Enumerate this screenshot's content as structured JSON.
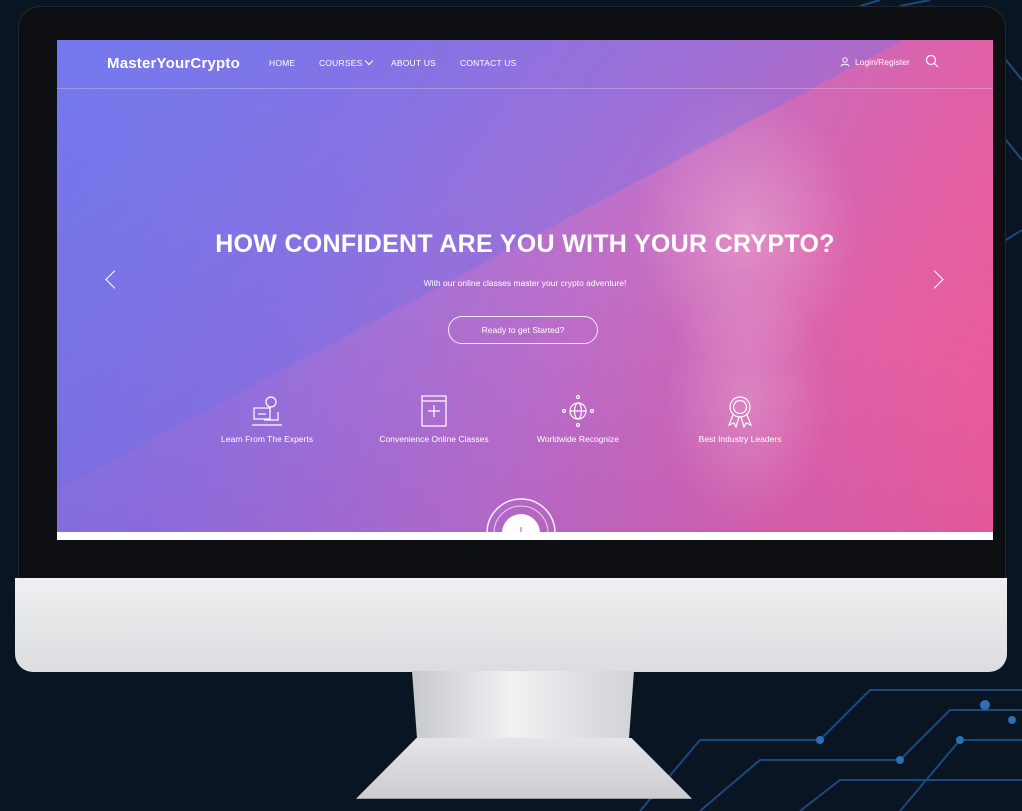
{
  "nav": {
    "logo": "MasterYourCrypto",
    "links": [
      "HOME",
      "COURSES",
      "ABOUT US",
      "CONTACT US"
    ],
    "login_label": "Login/Register"
  },
  "hero": {
    "title": "HOW CONFIDENT ARE YOU WITH YOUR CRYPTO?",
    "subtitle": "With our online classes master your crypto adventure!",
    "cta_label": "Ready to get Started?"
  },
  "features": [
    {
      "label": "Learn From The Experts",
      "icon": "expert-teacher-icon"
    },
    {
      "label": "Convenience Online Classes",
      "icon": "book-plus-icon"
    },
    {
      "label": "Worldwide Recognize",
      "icon": "globe-icon"
    },
    {
      "label": "Best Industry Leaders",
      "icon": "award-badge-icon"
    }
  ],
  "colors": {
    "gradient_start": "#7f86ee",
    "gradient_mid": "#c070c8",
    "gradient_end": "#ee5a95",
    "background": "#0a1524"
  }
}
